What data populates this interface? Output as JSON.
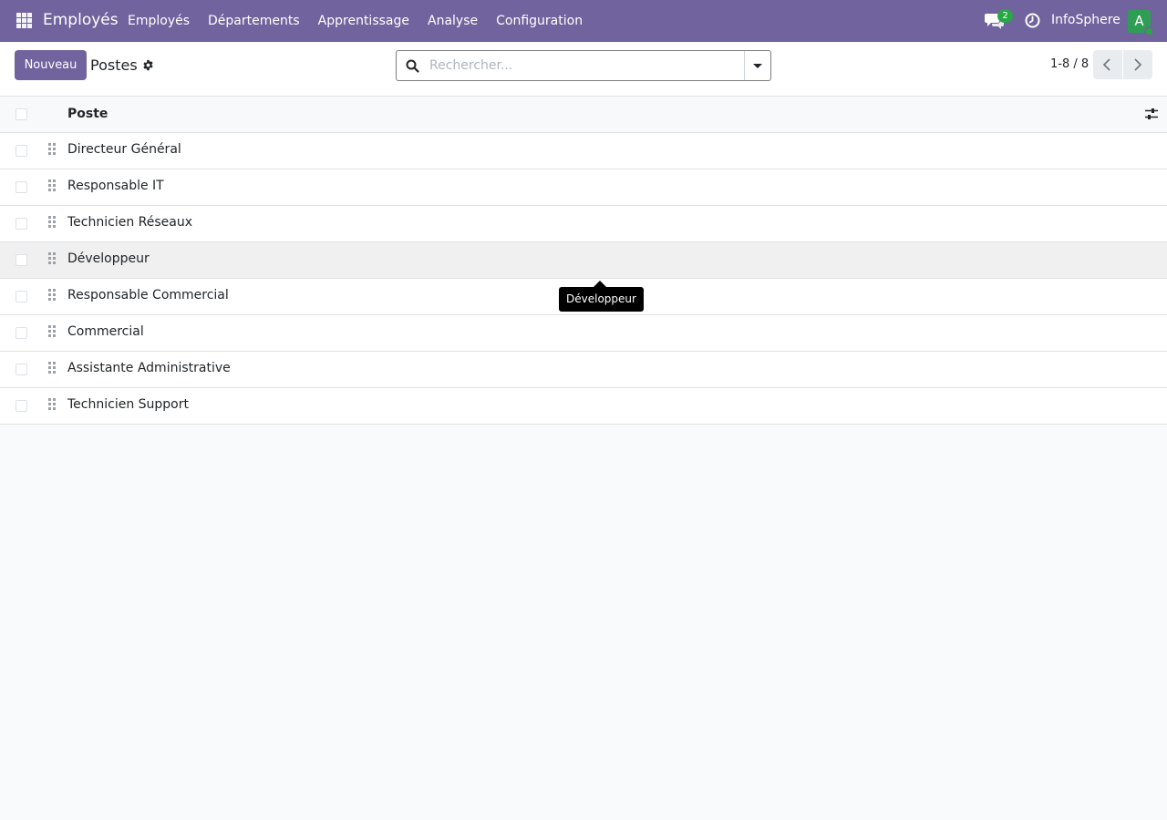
{
  "navbar": {
    "app_name": "Employés",
    "menu": [
      {
        "label": "Employés"
      },
      {
        "label": "Départements"
      },
      {
        "label": "Apprentissage"
      },
      {
        "label": "Analyse"
      },
      {
        "label": "Configuration"
      }
    ],
    "chat_count": "2",
    "company": "InfoSphere",
    "avatar_initial": "A"
  },
  "control_panel": {
    "new_label": "Nouveau",
    "title": "Postes",
    "search_placeholder": "Rechercher...",
    "pager": "1-8 / 8"
  },
  "list": {
    "column_header": "Poste",
    "rows": [
      {
        "name": "Directeur Général"
      },
      {
        "name": "Responsable IT"
      },
      {
        "name": "Technicien Réseaux"
      },
      {
        "name": "Développeur"
      },
      {
        "name": "Responsable Commercial"
      },
      {
        "name": "Commercial"
      },
      {
        "name": "Assistante Administrative"
      },
      {
        "name": "Technicien Support"
      }
    ]
  },
  "tooltip": {
    "text": "Développeur"
  },
  "colors": {
    "brand": "#71639e",
    "badge": "#28a745",
    "avatar": "#2f9e55"
  }
}
